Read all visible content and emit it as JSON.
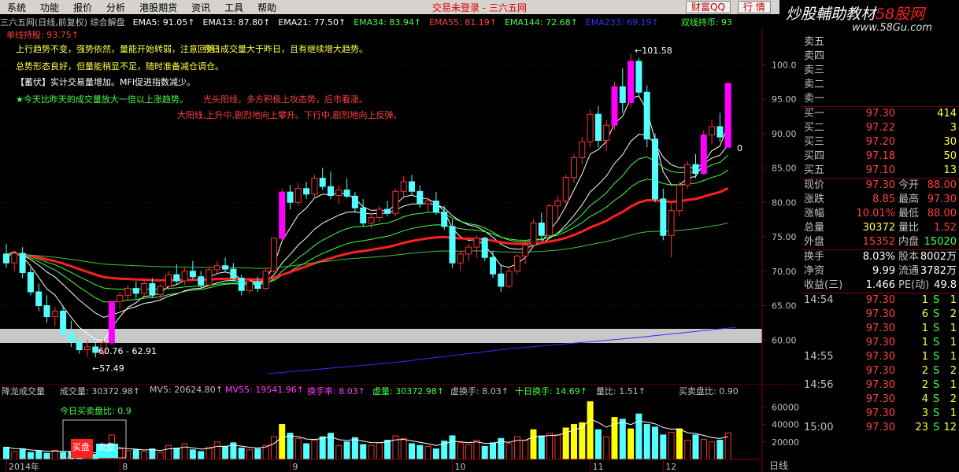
{
  "menu": [
    "系统",
    "功能",
    "报价",
    "分析",
    "港股期货",
    "资讯",
    "工具",
    "帮助"
  ],
  "status": "交易未登录 - 三六五网",
  "buttons": {
    "caifu": "财富QQ",
    "hangqing": "行 情"
  },
  "logo": {
    "part1": "炒股輔助教材",
    "part2": "58股网",
    "url": "www.58Gu.com"
  },
  "indicator_bar": {
    "title": "三六五网(日线,前复权) 综合解盘",
    "ema5": "EMA5: 91.05↑",
    "ema13": "EMA13: 87.80↑",
    "ema21": "EMA21: 77.50↑",
    "ema34": "EMA34: 83.94↑",
    "ema55": "EMA55: 81.19↑",
    "ema144": "EMA144: 72.68↑",
    "ema233": "EMA233: 69.19↑",
    "right": "双线持币: 93"
  },
  "annotations": {
    "a0": "单线持股: 93.75↑",
    "a1": "上行趋势不变，强势依然，量能开始转弱，注意回落！",
    "a1b": "今日成交量大于昨日，且有继续增大趋势。",
    "a2": "总势形态良好，但量能稍显不足，随时准备减仓调仓。",
    "a3": "【蓄伏】实计交易量增加。MFI促进指数减少。",
    "a4": "★今天比昨天的成交量放大一倍以上涨趋势。",
    "a4b": "光头阳线，多方积极上攻态势，后市看涨。",
    "a5": "大阳线,上升中,剧烈地向上攀升。下行中,剧烈地向上反弹。"
  },
  "chart_labels": {
    "high": "←101.58",
    "band": "60.76 - 62.91",
    "low": "←57.49",
    "last": "0"
  },
  "price_axis": [
    "100.0",
    "95.00",
    "90.00",
    "85.00",
    "80.00",
    "75.00",
    "70.00",
    "65.00",
    "60.00"
  ],
  "vol_bar": {
    "name": "降龙成交量",
    "vol": "成交量: 30372.98↑",
    "mv5": "MV5: 20624.80↑",
    "mv55": "MV55: 19541.96↑",
    "hs": "换手率: 8.03↑",
    "xu": "虚量: 30372.98↑",
    "xhs": "虚换手: 8.03↑",
    "sr": "十日换手: 14.69↑",
    "lb": "量比: 1.51↑",
    "mmb": "买卖盘比: 0.90"
  },
  "vol_labels": {
    "today": "今日买卖盘比: 0.9",
    "buy": "买盘",
    "sell": "卖盘"
  },
  "vol_axis": [
    "60000",
    "40000",
    "20000"
  ],
  "date_axis": [
    {
      "t": "2014年",
      "i": 0
    },
    {
      "t": "8",
      "i": 14
    },
    {
      "t": "9",
      "i": 35
    },
    {
      "t": "10",
      "i": 55
    },
    {
      "t": "11",
      "i": 72
    },
    {
      "t": "12",
      "i": 81
    }
  ],
  "bottom_tab": "日线",
  "orderbook": {
    "sell": [
      [
        "卖五",
        "",
        ""
      ],
      [
        "卖四",
        "",
        ""
      ],
      [
        "卖三",
        "",
        ""
      ],
      [
        "卖二",
        "",
        ""
      ],
      [
        "卖一",
        "",
        ""
      ]
    ],
    "buy": [
      [
        "买一",
        "97.30",
        "414"
      ],
      [
        "买二",
        "97.22",
        "3"
      ],
      [
        "买三",
        "97.20",
        "30"
      ],
      [
        "买四",
        "97.18",
        "50"
      ],
      [
        "买五",
        "97.10",
        "13"
      ]
    ]
  },
  "stats": [
    [
      "现价",
      "97.30",
      "今开",
      "88.00"
    ],
    [
      "涨跌",
      "8.85",
      "最高",
      "97.30"
    ],
    [
      "涨幅",
      "10.01%",
      "最低",
      "88.00"
    ],
    [
      "总量",
      "30372",
      "量比",
      "1.52"
    ],
    [
      "外盘",
      "15352",
      "内盘",
      "15020"
    ]
  ],
  "stats2": [
    [
      "换手",
      "8.03%",
      "股本",
      "8002万"
    ],
    [
      "净资",
      "9.99",
      "流通",
      "3782万"
    ],
    [
      "收益(三)",
      "1.466",
      "PE(动)",
      "49.8"
    ]
  ],
  "ticks": [
    [
      "14:54",
      "97.30",
      "1",
      "S",
      "1"
    ],
    [
      "",
      "97.30",
      "6",
      "S",
      "2"
    ],
    [
      "",
      "97.30",
      "1",
      "S",
      "1"
    ],
    [
      "",
      "97.30",
      "1",
      "S",
      "1"
    ],
    [
      "14:55",
      "97.30",
      "1",
      "S",
      "1"
    ],
    [
      "",
      "97.30",
      "2",
      "S",
      "2"
    ],
    [
      "14:56",
      "97.30",
      "2",
      "S",
      "1"
    ],
    [
      "",
      "97.30",
      "4",
      "S",
      "2"
    ],
    [
      "",
      "97.30",
      "3",
      "S",
      "1"
    ],
    [
      "15:00",
      "97.30",
      "23",
      "S",
      "12"
    ]
  ],
  "chart_data": {
    "type": "candlestick",
    "ylim": [
      55,
      103
    ],
    "ohlc": [
      [
        72.5,
        74.0,
        70.5,
        71.2
      ],
      [
        71.2,
        73.0,
        70.0,
        72.6
      ],
      [
        72.6,
        73.5,
        69.0,
        69.8
      ],
      [
        69.8,
        70.5,
        66.5,
        67.0
      ],
      [
        67.0,
        68.2,
        64.2,
        65.0
      ],
      [
        65.0,
        66.5,
        62.5,
        63.4
      ],
      [
        63.4,
        64.8,
        62.0,
        64.2
      ],
      [
        64.2,
        65.0,
        60.5,
        61.0
      ],
      [
        61.0,
        62.8,
        59.0,
        59.8
      ],
      [
        59.8,
        61.0,
        58.0,
        58.6
      ],
      [
        58.6,
        60.0,
        57.5,
        59.0
      ],
      [
        59.0,
        60.5,
        57.49,
        58.2
      ],
      [
        58.2,
        60.0,
        57.8,
        59.6
      ],
      [
        59.6,
        65.6,
        59.4,
        65.6
      ],
      [
        65.6,
        67.0,
        64.5,
        66.5
      ],
      [
        66.5,
        68.0,
        65.8,
        67.5
      ],
      [
        67.5,
        68.5,
        66.0,
        66.8
      ],
      [
        66.8,
        68.8,
        66.5,
        68.2
      ],
      [
        68.2,
        69.0,
        66.2,
        66.6
      ],
      [
        66.6,
        68.2,
        66.0,
        67.8
      ],
      [
        67.8,
        70.0,
        67.2,
        69.5
      ],
      [
        69.5,
        71.0,
        68.0,
        68.6
      ],
      [
        68.6,
        70.5,
        68.0,
        70.0
      ],
      [
        70.0,
        71.5,
        68.8,
        69.2
      ],
      [
        69.2,
        70.0,
        67.5,
        68.0
      ],
      [
        68.0,
        70.5,
        67.8,
        70.2
      ],
      [
        70.2,
        71.5,
        69.4,
        70.8
      ],
      [
        70.8,
        72.0,
        69.8,
        70.3
      ],
      [
        70.3,
        71.2,
        68.5,
        69.0
      ],
      [
        69.0,
        69.5,
        66.5,
        67.2
      ],
      [
        67.2,
        69.0,
        66.8,
        68.5
      ],
      [
        68.5,
        69.2,
        67.0,
        67.5
      ],
      [
        67.5,
        70.5,
        67.2,
        70.0
      ],
      [
        70.0,
        74.8,
        69.8,
        74.8
      ],
      [
        74.8,
        82.0,
        74.5,
        81.5
      ],
      [
        81.5,
        82.5,
        79.0,
        80.0
      ],
      [
        80.0,
        82.8,
        79.5,
        82.0
      ],
      [
        82.0,
        83.0,
        80.5,
        81.2
      ],
      [
        81.2,
        84.0,
        80.8,
        83.5
      ],
      [
        83.5,
        85.0,
        81.8,
        82.3
      ],
      [
        82.3,
        84.5,
        80.5,
        81.0
      ],
      [
        81.0,
        82.5,
        79.8,
        81.8
      ],
      [
        81.8,
        83.5,
        80.6,
        80.9
      ],
      [
        80.9,
        81.5,
        78.5,
        79.2
      ],
      [
        79.2,
        80.5,
        76.5,
        77.0
      ],
      [
        77.0,
        78.5,
        76.2,
        77.8
      ],
      [
        77.8,
        79.5,
        77.2,
        79.0
      ],
      [
        79.0,
        80.2,
        78.0,
        78.4
      ],
      [
        78.4,
        82.0,
        78.0,
        81.6
      ],
      [
        81.6,
        83.8,
        80.8,
        83.0
      ],
      [
        83.0,
        84.0,
        81.0,
        81.6
      ],
      [
        81.6,
        82.5,
        79.2,
        79.8
      ],
      [
        79.8,
        80.8,
        78.6,
        80.2
      ],
      [
        80.2,
        81.5,
        78.2,
        78.6
      ],
      [
        78.6,
        79.5,
        76.0,
        76.5
      ],
      [
        76.5,
        77.5,
        70.5,
        71.2
      ],
      [
        71.2,
        73.0,
        70.0,
        72.5
      ],
      [
        72.5,
        74.0,
        71.5,
        73.5
      ],
      [
        73.5,
        75.2,
        72.0,
        74.8
      ],
      [
        74.8,
        75.0,
        71.5,
        72.0
      ],
      [
        72.0,
        73.0,
        69.0,
        69.6
      ],
      [
        69.6,
        71.0,
        67.0,
        67.8
      ],
      [
        67.8,
        70.5,
        67.5,
        70.0
      ],
      [
        70.0,
        72.5,
        69.5,
        72.2
      ],
      [
        72.2,
        74.5,
        71.0,
        73.8
      ],
      [
        73.8,
        77.5,
        73.5,
        77.0
      ],
      [
        77.0,
        78.5,
        74.5,
        75.2
      ],
      [
        75.2,
        79.8,
        75.0,
        79.5
      ],
      [
        79.5,
        81.0,
        77.5,
        80.2
      ],
      [
        80.2,
        84.0,
        79.8,
        83.6
      ],
      [
        83.6,
        87.0,
        82.8,
        86.5
      ],
      [
        86.5,
        89.5,
        85.5,
        88.8
      ],
      [
        88.8,
        93.5,
        88.0,
        92.8
      ],
      [
        92.8,
        94.0,
        88.0,
        89.0
      ],
      [
        89.0,
        92.0,
        87.5,
        91.2
      ],
      [
        91.2,
        97.5,
        90.5,
        96.8
      ],
      [
        96.8,
        99.5,
        93.0,
        94.5
      ],
      [
        94.5,
        101.58,
        93.8,
        100.5
      ],
      [
        100.5,
        101.0,
        95.5,
        96.0
      ],
      [
        96.0,
        97.0,
        88.0,
        89.2
      ],
      [
        89.2,
        90.0,
        80.0,
        80.5
      ],
      [
        80.5,
        82.0,
        74.5,
        75.2
      ],
      [
        75.2,
        80.0,
        72.0,
        78.8
      ],
      [
        78.8,
        83.0,
        78.0,
        82.5
      ],
      [
        82.5,
        86.0,
        82.0,
        85.5
      ],
      [
        85.5,
        87.0,
        83.5,
        84.2
      ],
      [
        84.2,
        90.5,
        84.0,
        89.8
      ],
      [
        89.8,
        92.0,
        88.5,
        91.0
      ],
      [
        91.0,
        93.0,
        88.8,
        89.5
      ],
      [
        88.0,
        97.3,
        88.0,
        97.3
      ]
    ],
    "volume": [
      14000,
      9000,
      12000,
      8000,
      9500,
      7000,
      10500,
      8000,
      9000,
      7500,
      8500,
      6000,
      5000,
      28000,
      12000,
      10000,
      11000,
      9000,
      12000,
      8000,
      16000,
      13000,
      18000,
      11000,
      9000,
      14000,
      20000,
      15000,
      19000,
      13000,
      11000,
      12000,
      16000,
      26000,
      40000,
      30000,
      24000,
      18000,
      22000,
      26000,
      30000,
      16000,
      20000,
      25000,
      17000,
      16000,
      19000,
      22000,
      27000,
      24000,
      18000,
      16000,
      15000,
      12000,
      21000,
      27000,
      19000,
      17000,
      22000,
      15000,
      19000,
      24000,
      18000,
      26000,
      22000,
      34000,
      27000,
      30000,
      28000,
      36000,
      40000,
      42000,
      66000,
      34000,
      26000,
      48000,
      46000,
      35000,
      52000,
      40000,
      37000,
      28000,
      31000,
      35000,
      22000,
      28000,
      23000,
      20000,
      22000,
      30373
    ],
    "ema_fast": "EMA5",
    "ema_slow": "EMA233"
  }
}
